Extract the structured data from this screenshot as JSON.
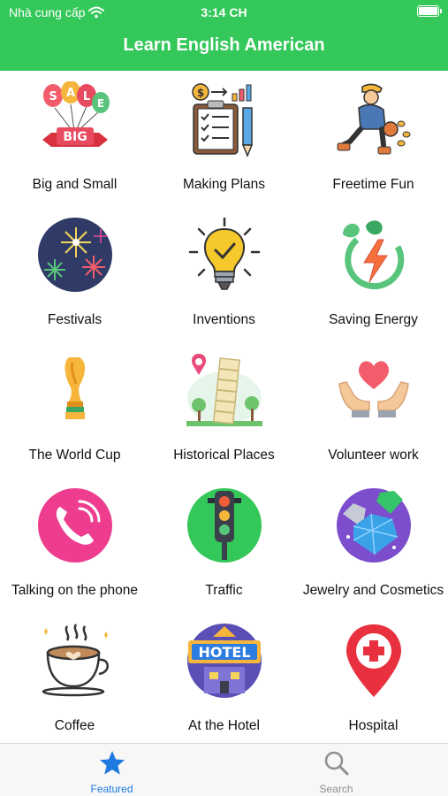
{
  "status_bar": {
    "carrier": "Nhà cung cấp",
    "time": "3:14 CH"
  },
  "header": {
    "title": "Learn English American"
  },
  "topics": [
    {
      "label": "Big and Small",
      "icon": "sale-balloons-icon"
    },
    {
      "label": "Making Plans",
      "icon": "checklist-plan-icon"
    },
    {
      "label": "Freetime Fun",
      "icon": "basketball-player-icon"
    },
    {
      "label": "Festivals",
      "icon": "fireworks-icon"
    },
    {
      "label": "Inventions",
      "icon": "lightbulb-icon"
    },
    {
      "label": "Saving Energy",
      "icon": "eco-energy-icon"
    },
    {
      "label": "The World Cup",
      "icon": "trophy-icon"
    },
    {
      "label": "Historical Places",
      "icon": "leaning-tower-icon"
    },
    {
      "label": "Volunteer work",
      "icon": "hands-heart-icon"
    },
    {
      "label": "Talking on the phone",
      "icon": "phone-call-icon"
    },
    {
      "label": "Traffic",
      "icon": "traffic-light-icon"
    },
    {
      "label": "Jewelry and Cosmetics",
      "icon": "gems-icon"
    },
    {
      "label": "Coffee",
      "icon": "coffee-cup-icon"
    },
    {
      "label": "At the Hotel",
      "icon": "hotel-sign-icon"
    },
    {
      "label": "Hospital",
      "icon": "hospital-pin-icon"
    }
  ],
  "tabbar": {
    "featured": {
      "label": "Featured",
      "icon": "star-icon"
    },
    "search": {
      "label": "Search",
      "icon": "search-icon"
    }
  },
  "colors": {
    "header_green": "#34c759",
    "tab_active": "#1f7ae0",
    "tab_inactive": "#8e8e93"
  }
}
